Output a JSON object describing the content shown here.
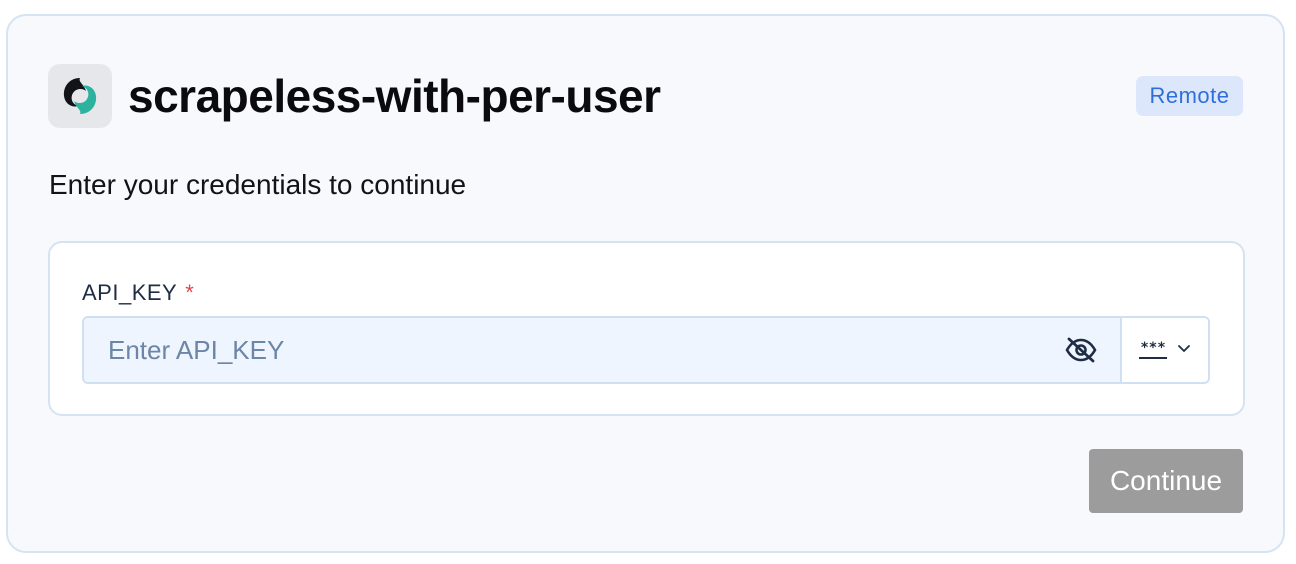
{
  "header": {
    "title": "scrapeless-with-per-user",
    "badge": "Remote",
    "logo_icon": "scrapeless-logo-icon"
  },
  "form": {
    "subtitle": "Enter your credentials to continue",
    "field": {
      "label": "API_KEY",
      "required_marker": "*",
      "value": "",
      "placeholder": "Enter API_KEY",
      "visibility_icon": "eye-slash-icon",
      "mask_mode": "***",
      "mask_dropdown_icon": "chevron-down-icon"
    },
    "continue_label": "Continue"
  },
  "colors": {
    "accent": "#2f6fdb",
    "badge_bg": "#dce7fb",
    "required": "#e0484b",
    "button_disabled": "#9c9c9c",
    "border": "#d5e3f3",
    "logo_teal": "#2bb3a0"
  }
}
